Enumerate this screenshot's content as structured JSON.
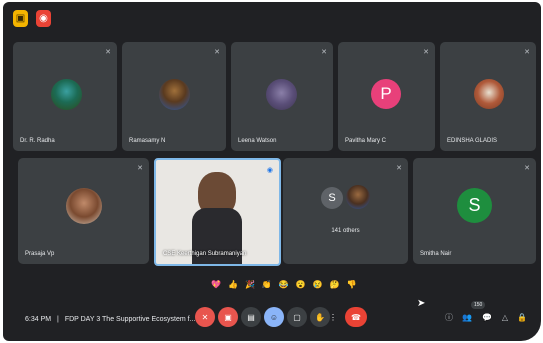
{
  "participants_row1": [
    {
      "name": "Dr. R. Radha",
      "avatar": "peacock-photo"
    },
    {
      "name": "Ramasamy N",
      "avatar": "man-photo"
    },
    {
      "name": "Leena Watson",
      "avatar": "profile-photo"
    },
    {
      "name": "Pavitha Mary C",
      "avatar_letter": "P",
      "avatar_color": "#e8407a"
    },
    {
      "name": "EDINSHA GLADIS",
      "avatar": "group-photo"
    }
  ],
  "participants_row2": [
    {
      "name": "Prasaja Vp",
      "avatar": "woman-photo"
    },
    {
      "name": "CSE Keerthigan Subramaniyan",
      "role": "presenter-self-view"
    },
    {
      "name": "141 others",
      "avatar_letter": "S",
      "avatar_color": "#5f6368"
    },
    {
      "name": "Smitha Nair",
      "avatar_letter": "S",
      "avatar_color": "#1e8e3e"
    }
  ],
  "reactions": [
    "💖",
    "👍",
    "🎉",
    "👏",
    "😂",
    "😮",
    "😢",
    "🤔",
    "👎"
  ],
  "bottom_bar": {
    "time": "6:34 PM",
    "separator": "|",
    "meeting_title": "FDP DAY 3 The Supportive Ecosystem f...",
    "participant_count": "150"
  },
  "colors": {
    "background": "#202124",
    "tile": "#3c4043",
    "hangup": "#ea4335",
    "muted": "#e8554e",
    "active": "#8ab4f8"
  }
}
